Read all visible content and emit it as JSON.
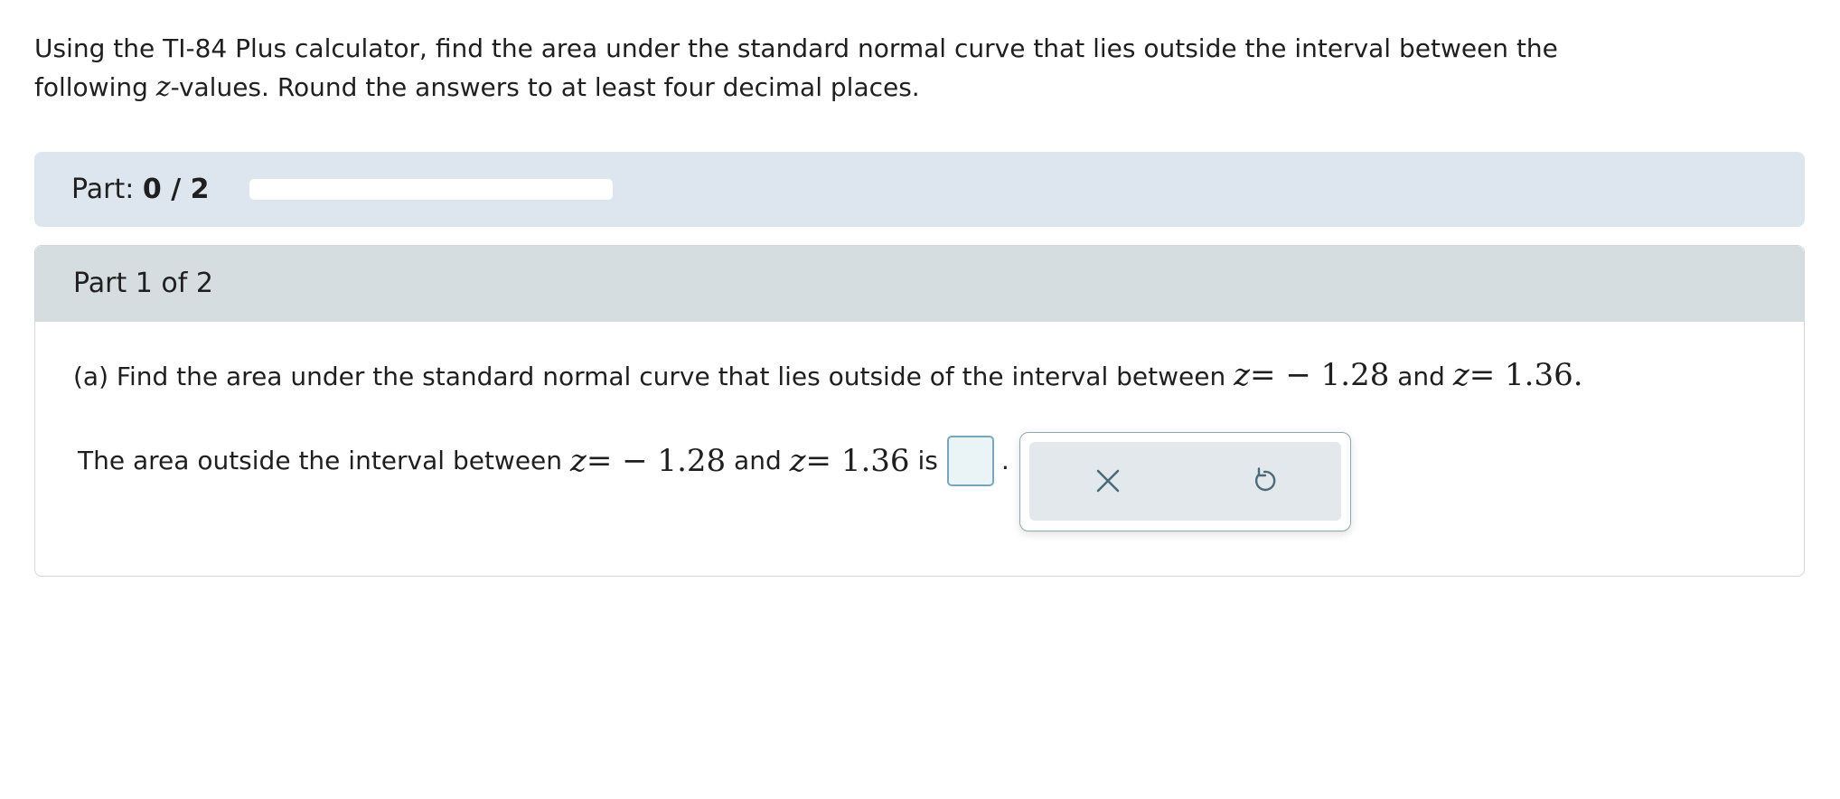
{
  "question": {
    "line1": "Using the TI-84 Plus calculator, find the area under the standard normal curve that lies outside the interval between the",
    "line2_before": "following ",
    "line2_var": "z",
    "line2_after": "-values. Round the answers to at least four decimal places."
  },
  "progress": {
    "label": "Part: ",
    "count": "0 / 2",
    "fraction": 0
  },
  "part": {
    "header": "Part 1 of 2",
    "prompt_text": "(a) Find the area under the standard normal curve that lies outside of the interval between ",
    "z_var": "z",
    "z1_expr": "= − 1.28",
    "and_text": " and ",
    "z2_expr": "= 1.36",
    "prompt_end": ".",
    "answer_text": "The area outside the interval between ",
    "answer_is": " is",
    "answer_value": "",
    "answer_period": "."
  },
  "tools": {
    "clear_icon": "close-icon",
    "undo_icon": "undo-icon",
    "icon_color": "#4b6b7b"
  },
  "colors": {
    "progress_bg": "#dde6ef",
    "header_bg": "#d6dde1",
    "input_border": "#7aa6bd",
    "input_bg": "#eaf4f7"
  }
}
